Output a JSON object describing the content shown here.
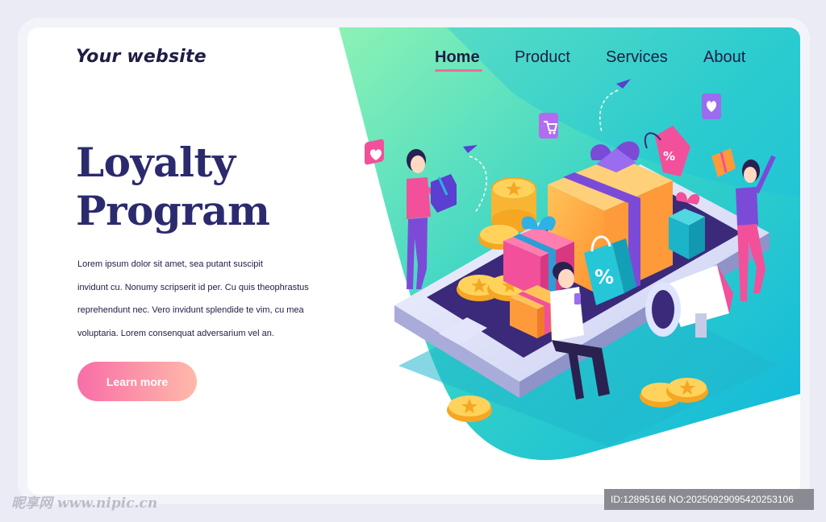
{
  "header": {
    "logo": "Your website",
    "nav": [
      "Home",
      "Product",
      "Services",
      "About"
    ]
  },
  "hero": {
    "title_line1": "Loyalty",
    "title_line2": "Program",
    "description": [
      "Lorem ipsum dolor sit amet, sea putant suscipit",
      "invidunt cu. Nonumy scripserit id per. Cu quis theophrastus",
      "reprehendunt nec. Vero invidunt splendide te vim, cu mea",
      "voluptaria. Lorem consenquat adversarium vel an."
    ],
    "button_label": "Learn more",
    "illustration": {
      "badge_text": "%",
      "tag_text": "%"
    }
  },
  "watermark": {
    "left": "昵享网 www.nipic.cn",
    "right": "ID:12895166 NO:20250929095420253106"
  },
  "colors": {
    "accent": "#2c2a6e",
    "underline": "#f06a9a",
    "button_start": "#f86ea8",
    "button_end": "#ffb9a9",
    "teal": "#1ec7d6",
    "green": "#7ff0b0"
  }
}
